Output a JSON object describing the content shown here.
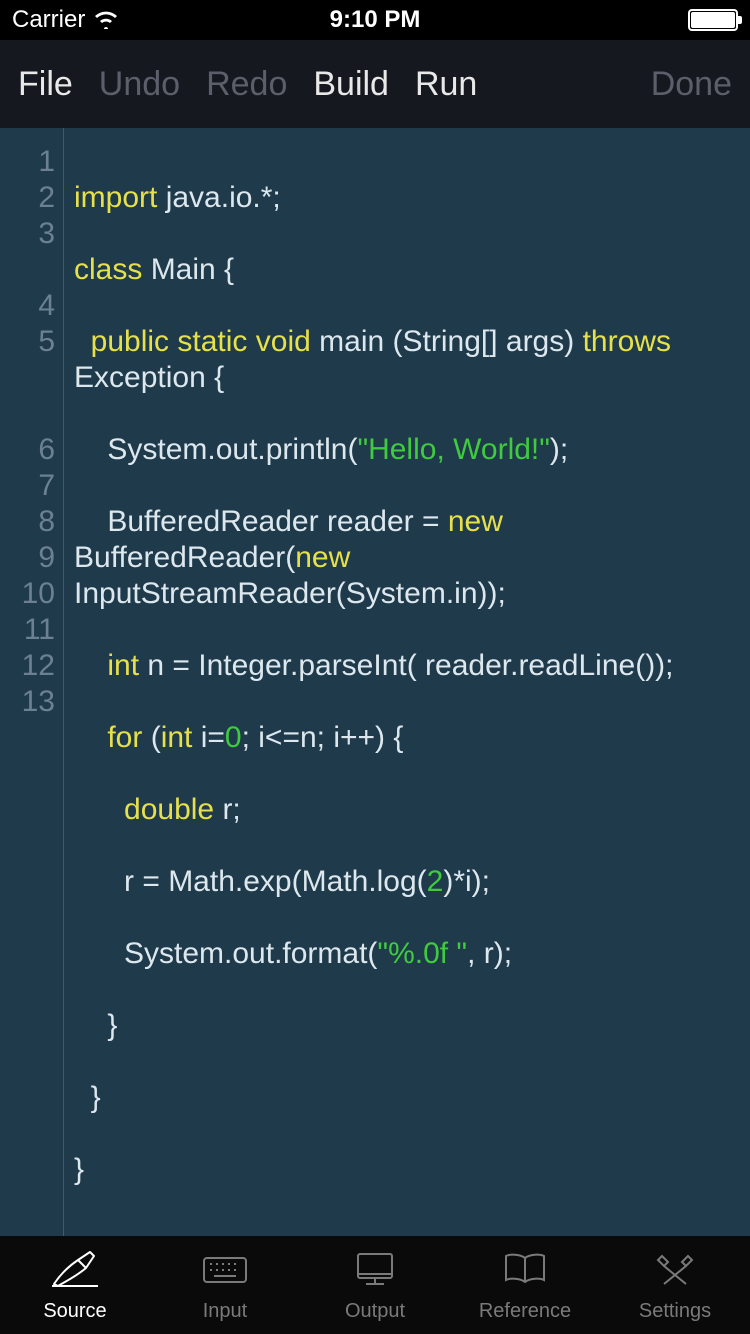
{
  "status": {
    "carrier": "Carrier",
    "time": "9:10 PM"
  },
  "toolbar": {
    "file": "File",
    "undo": "Undo",
    "redo": "Redo",
    "build": "Build",
    "run": "Run",
    "done": "Done"
  },
  "tabs": {
    "source": "Source",
    "input": "Input",
    "output": "Output",
    "reference": "Reference",
    "settings": "Settings"
  },
  "line_numbers": [
    "1",
    "2",
    "3",
    "",
    "4",
    "5",
    "",
    "",
    "6",
    "7",
    "8",
    "9",
    "10",
    "11",
    "12",
    "13"
  ],
  "code": {
    "l1": {
      "t0": "import",
      "t1": " java.io.*;"
    },
    "l2": {
      "t0": "class",
      "t1": " Main {"
    },
    "l3": {
      "t0": "  ",
      "t1": "public",
      "t2": " ",
      "t3": "static",
      "t4": " ",
      "t5": "void",
      "t6": " main (String[] args) ",
      "t7": "throws",
      "t8": " Exception {"
    },
    "l4": {
      "t0": "    System.out.println(",
      "t1": "\"Hello, World!\"",
      "t2": ");"
    },
    "l5": {
      "t0": "    BufferedReader reader = ",
      "t1": "new",
      "t2": " BufferedReader(",
      "t3": "new",
      "t4": " InputStreamReader(System.in));"
    },
    "l6": {
      "t0": "    ",
      "t1": "int",
      "t2": " n = Integer.parseInt( reader.readLine());"
    },
    "l7": {
      "t0": "    ",
      "t1": "for",
      "t2": " (",
      "t3": "int",
      "t4": " i=",
      "t5": "0",
      "t6": "; i<=n; i++) {"
    },
    "l8": {
      "t0": "      ",
      "t1": "double",
      "t2": " r;"
    },
    "l9": {
      "t0": "      r = Math.exp(Math.log(",
      "t1": "2",
      "t2": ")*i);"
    },
    "l10": {
      "t0": "      System.out.format(",
      "t1": "\"%.0f \"",
      "t2": ", r);"
    },
    "l11": {
      "t0": "    }"
    },
    "l12": {
      "t0": "  }"
    },
    "l13": {
      "t0": "}"
    }
  }
}
